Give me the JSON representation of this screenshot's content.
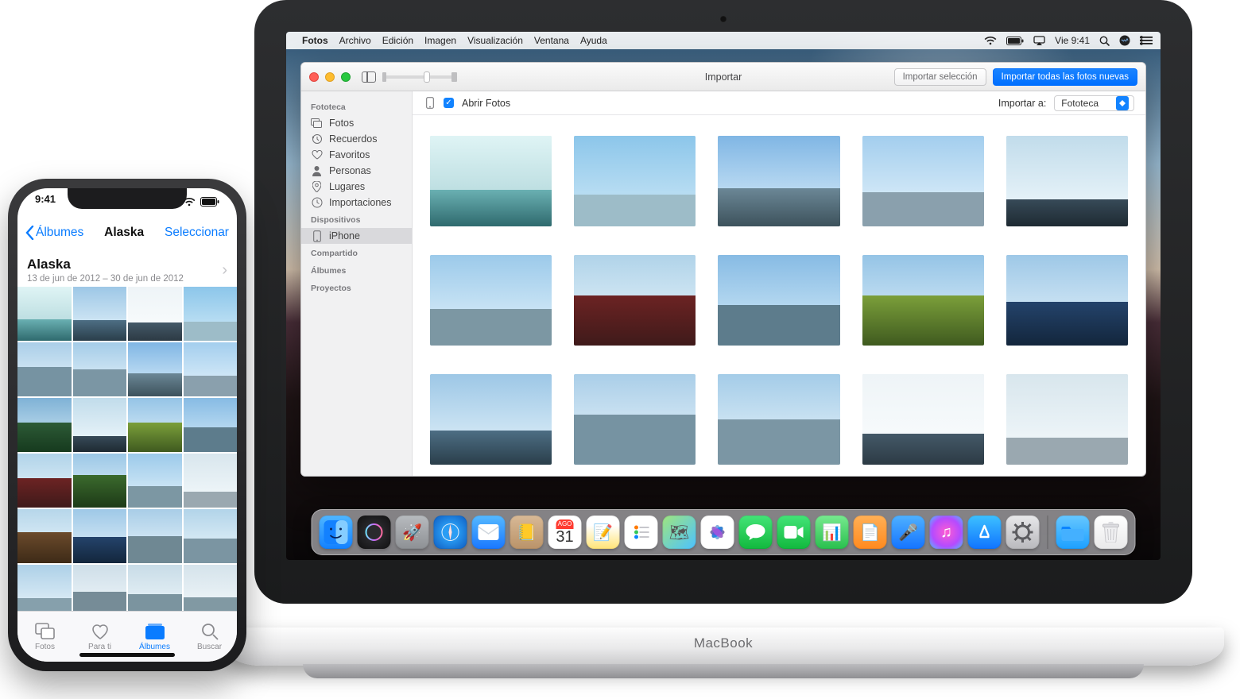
{
  "mac": {
    "menubar": {
      "app_name": "Fotos",
      "items": [
        "Archivo",
        "Edición",
        "Imagen",
        "Visualización",
        "Ventana",
        "Ayuda"
      ],
      "clock": "Vie 9:41"
    },
    "window": {
      "title": "Importar",
      "btn_import_selection": "Importar selección",
      "btn_import_all": "Importar todas las fotos nuevas",
      "importbar": {
        "open_photos": "Abrir Fotos",
        "import_to_label": "Importar a:",
        "import_to_value": "Fototeca"
      },
      "sidebar": {
        "sections": [
          {
            "title": "Fototeca",
            "items": [
              {
                "icon": "photos",
                "label": "Fotos"
              },
              {
                "icon": "memories",
                "label": "Recuerdos"
              },
              {
                "icon": "favorites",
                "label": "Favoritos"
              },
              {
                "icon": "people",
                "label": "Personas"
              },
              {
                "icon": "places",
                "label": "Lugares"
              },
              {
                "icon": "imports",
                "label": "Importaciones"
              }
            ]
          },
          {
            "title": "Dispositivos",
            "items": [
              {
                "icon": "iphone",
                "label": "iPhone",
                "selected": true
              }
            ]
          },
          {
            "title": "Compartido",
            "items": []
          },
          {
            "title": "Álbumes",
            "items": []
          },
          {
            "title": "Proyectos",
            "items": []
          }
        ]
      }
    },
    "logo": "MacBook",
    "dock": {
      "apps": [
        "finder",
        "siri",
        "launchpad",
        "safari",
        "mail",
        "contacts",
        "calendar",
        "notes",
        "reminders",
        "maps",
        "photos",
        "messages",
        "facetime",
        "numbers",
        "pages",
        "keynote",
        "itunes",
        "appstore",
        "preferences"
      ],
      "calendar": {
        "month": "AGO",
        "day": "31"
      }
    }
  },
  "iphone": {
    "status_time": "9:41",
    "nav_back": "Álbumes",
    "nav_title": "Alaska",
    "nav_action": "Seleccionar",
    "album_title": "Alaska",
    "album_dates": "13 de jun de 2012 – 30 de jun de 2012",
    "tabs": [
      {
        "key": "photos",
        "label": "Fotos"
      },
      {
        "key": "foryou",
        "label": "Para ti"
      },
      {
        "key": "albums",
        "label": "Álbumes",
        "selected": true
      },
      {
        "key": "search",
        "label": "Buscar"
      }
    ]
  }
}
